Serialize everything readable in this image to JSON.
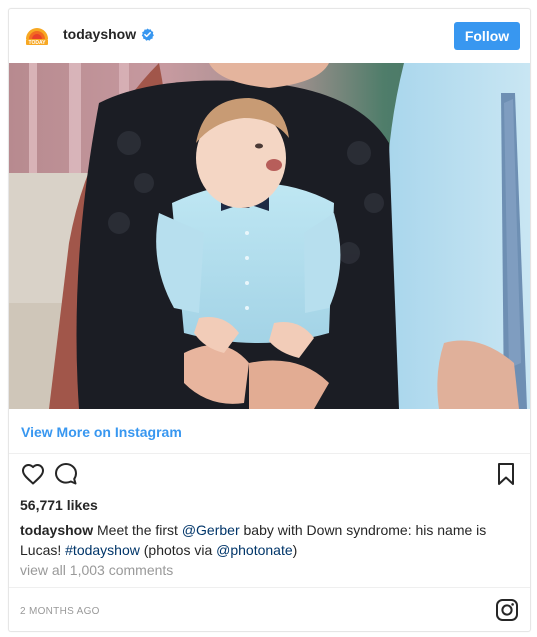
{
  "post": {
    "username": "todayshow",
    "follow_label": "Follow",
    "view_more_label": "View More on Instagram",
    "likes_text": "56,771 likes",
    "caption": {
      "user": "todayshow",
      "text_1": " Meet the first ",
      "mention_1": "@Gerber",
      "text_2": " baby with Down syndrome: his name is Lucas! ",
      "hashtag": "#todayshow",
      "text_3": " (photos via ",
      "mention_2": "@photonate",
      "text_4": ")"
    },
    "comments_link": "view all 1,003 comments",
    "timestamp": "2 MONTHS AGO"
  },
  "icons": {
    "logo": "today-show-logo",
    "verified": "verified-badge-icon",
    "like": "heart-icon",
    "comment": "comment-icon",
    "save": "bookmark-icon",
    "instagram": "instagram-icon"
  },
  "colors": {
    "accent": "#3897f0",
    "verified": "#3897f0",
    "link": "#003569",
    "muted": "#999999"
  }
}
